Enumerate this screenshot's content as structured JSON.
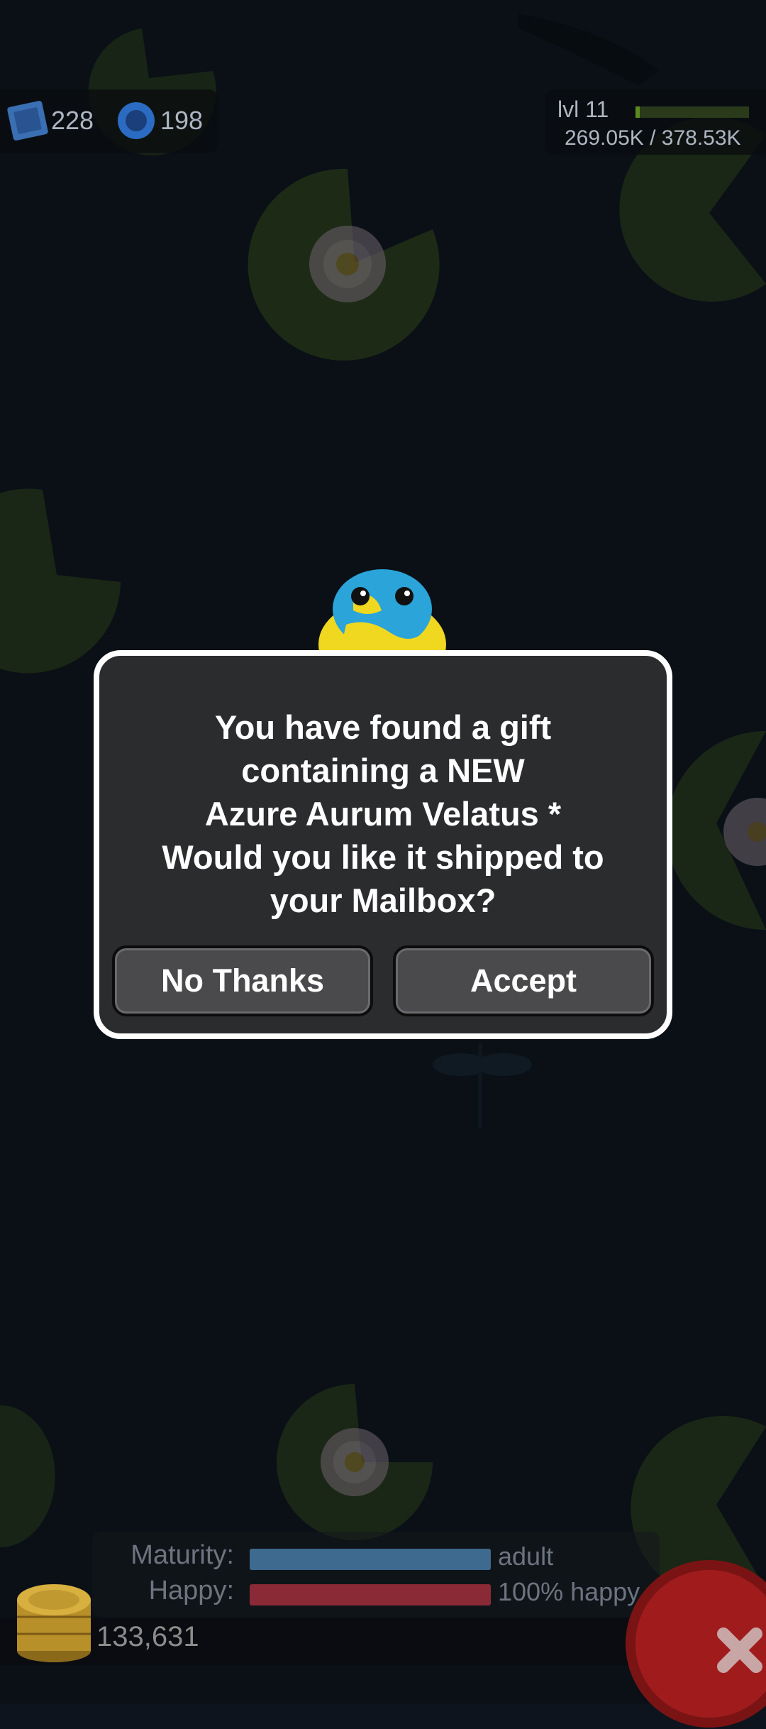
{
  "hud": {
    "stamps": "228",
    "gems": "198",
    "level": "lvl 11",
    "xp_text": "269.05K / 378.53K",
    "xp_progress": 0.04
  },
  "dialog": {
    "lines": [
      "You have found a gift",
      "containing a NEW",
      "Azure Aurum Velatus *",
      "Would you like it shipped to",
      "your Mailbox?"
    ],
    "no_label": "No Thanks",
    "accept_label": "Accept"
  },
  "stats": {
    "maturity_label": "Maturity:",
    "maturity_value": "adult",
    "maturity_progress": 1.0,
    "happy_label": "Happy:",
    "happy_value": "100% happy",
    "happy_progress": 1.0
  },
  "coins": "133,631",
  "colors": {
    "maturity_bar": "#3d6a8e",
    "happy_bar": "#8a2a36",
    "dialog_bg": "#2b2c2e",
    "button_bg": "#4a4a4c"
  },
  "icons": [
    "stamp-icon",
    "gem-icon",
    "frog-icon",
    "coins-icon",
    "close-icon",
    "dragonfly-icon"
  ]
}
